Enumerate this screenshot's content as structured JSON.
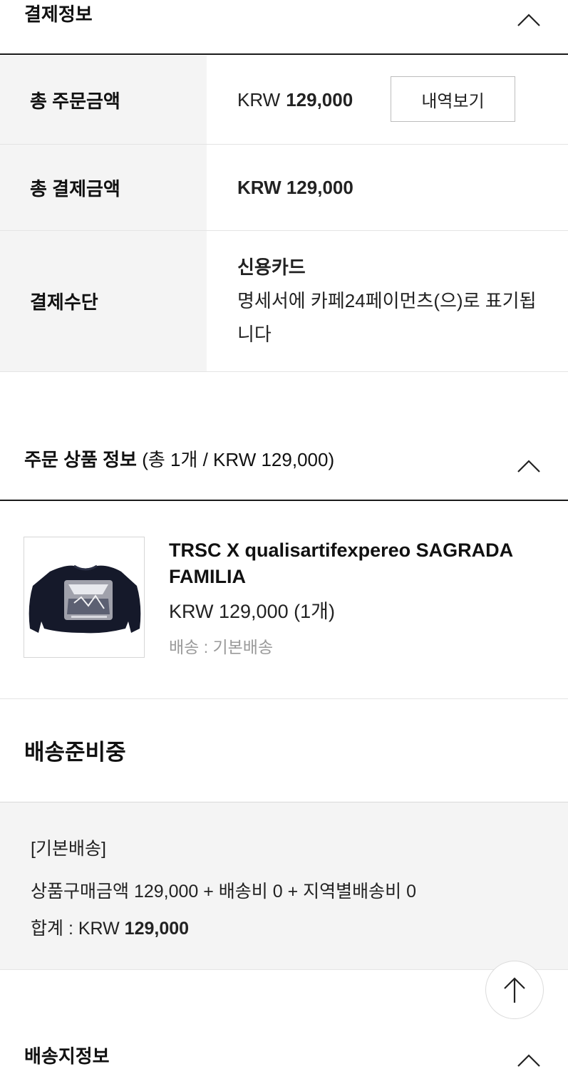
{
  "payment_section": {
    "title": "결제정보",
    "rows": [
      {
        "label": "총 주문금액",
        "currency": "KRW",
        "amount": "129,000",
        "button_label": "내역보기"
      },
      {
        "label": "총 결제금액",
        "value": "KRW 129,000"
      },
      {
        "label": "결제수단",
        "method": "신용카드",
        "note": "명세서에 카페24페이먼츠(으)로 표기됩니다"
      }
    ]
  },
  "order_items_section": {
    "title": "주문 상품 정보",
    "summary": "(총 1개 / KRW 129,000)"
  },
  "product": {
    "name": "TRSC X qualisartifexpereo SAGRADA FAMILIA",
    "price": "KRW 129,000 (1개)",
    "shipping": "배송 : 기본배송",
    "image_icon": "black-sweatshirt-image"
  },
  "delivery_status": "배송준비중",
  "shipping_summary": {
    "type": "[기본배송]",
    "breakdown": "상품구매금액 129,000 + 배송비 0 + 지역별배송비 0",
    "total_label": "합계 : KRW",
    "total_amount": "129,000"
  },
  "address_section": {
    "title": "배송지정보"
  },
  "icons": {
    "collapse": "chevron-up-icon",
    "scroll_top": "arrow-up-icon"
  }
}
